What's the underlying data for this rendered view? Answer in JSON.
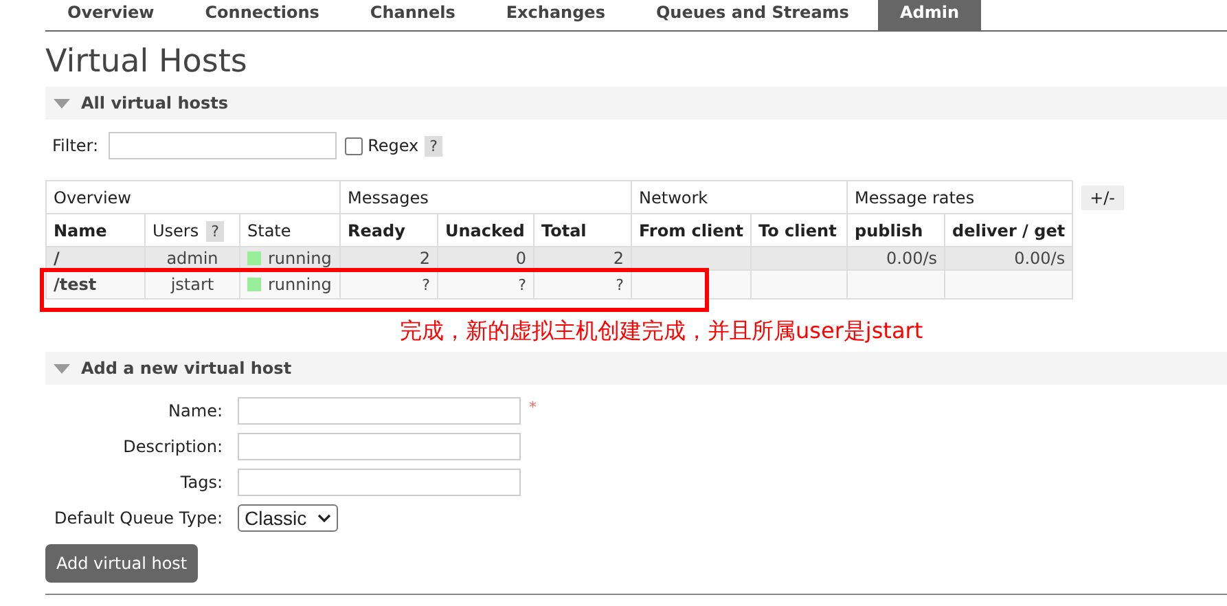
{
  "tabs": [
    {
      "label": "Overview",
      "selected": false
    },
    {
      "label": "Connections",
      "selected": false
    },
    {
      "label": "Channels",
      "selected": false
    },
    {
      "label": "Exchanges",
      "selected": false
    },
    {
      "label": "Queues and Streams",
      "selected": false
    },
    {
      "label": "Admin",
      "selected": true
    }
  ],
  "title": "Virtual Hosts",
  "hosts_section": {
    "heading": "All virtual hosts",
    "expanded": true,
    "filter": {
      "label": "Filter:",
      "regex_label": "Regex",
      "regex_checked": false,
      "help": "?"
    },
    "table": {
      "groups": [
        {
          "label": "Overview",
          "columns": [
            {
              "label": "Name"
            },
            {
              "label": "Users",
              "help": "?"
            },
            {
              "label": "State"
            }
          ]
        },
        {
          "label": "Messages",
          "columns": [
            {
              "label": "Ready"
            },
            {
              "label": "Unacked"
            },
            {
              "label": "Total"
            }
          ]
        },
        {
          "label": "Network",
          "columns": [
            {
              "label": "From client"
            },
            {
              "label": "To client"
            }
          ]
        },
        {
          "label": "Message rates",
          "columns": [
            {
              "label": "publish"
            },
            {
              "label": "deliver / get"
            }
          ]
        }
      ],
      "rows": [
        {
          "name": "/",
          "users": "admin",
          "state": "running",
          "color": "#99ee99",
          "ready": "2",
          "unacked": "0",
          "total": "2",
          "publish": "0.00/s",
          "deliver_get": "0.00/s"
        },
        {
          "name": "/test",
          "users": "jstart",
          "state": "running",
          "color": "#99ee99",
          "ready": "?",
          "unacked": "?",
          "total": "?"
        }
      ]
    },
    "columns_toggle": "+/-"
  },
  "annotation": {
    "text": "完成，新的虚拟主机创建完成，并且所属user是jstart"
  },
  "add_section": {
    "heading": "Add a new virtual host",
    "expanded": true,
    "fields": [
      {
        "kind": "text",
        "label": "Name:",
        "required": true
      },
      {
        "kind": "text",
        "label": "Description:",
        "required": false
      },
      {
        "kind": "text",
        "label": "Tags:",
        "required": false
      },
      {
        "kind": "select",
        "label": "Default Queue Type:",
        "value": "Classic",
        "required": false
      }
    ],
    "required_mark": "*",
    "button": "Add virtual host"
  }
}
